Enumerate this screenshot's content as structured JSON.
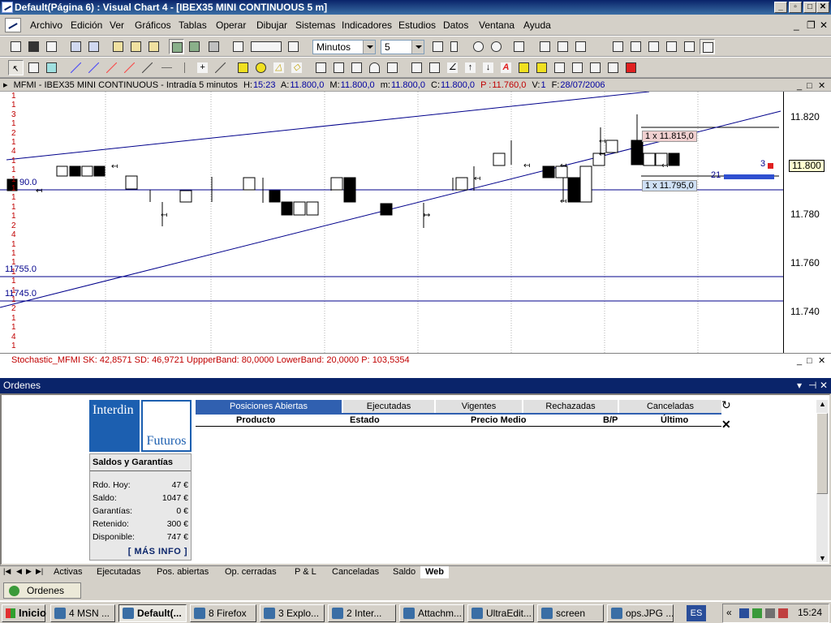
{
  "window": {
    "title": "Default(Página 6) : Visual Chart 4 - [IBEX35 MINI CONTINUOUS 5 m]"
  },
  "menu": [
    "Archivo",
    "Edición",
    "Ver",
    "Gráficos",
    "Tablas",
    "Operar",
    "Dibujar",
    "Sistemas",
    "Indicadores",
    "Estudios",
    "Datos",
    "Ventana",
    "Ayuda"
  ],
  "toolbar": {
    "period_select": "Minutos",
    "interval_select": "5"
  },
  "chart_header": {
    "symbol": "MFMI - IBEX35 MINI CONTINUOUS - Intradía 5 minutos",
    "hour_label": "H:",
    "hour": "15:23",
    "open_label": "A:",
    "open": "11.800,0",
    "high_label": "M:",
    "high": "11.800,0",
    "low_label": "m:",
    "low": "11.800,0",
    "close_label": "C:",
    "close": "11.800,0",
    "p_label": "P :",
    "p": "11.760,0",
    "vol_label": "V:",
    "vol": "1",
    "date_label": "F:",
    "date": "28/07/2006"
  },
  "chart": {
    "price_labels": [
      "11.820",
      "11.800",
      "11.780",
      "11.760",
      "11.740"
    ],
    "current_price": "11.800",
    "order_sell": "1 x 11.815,0",
    "order_buy": "1 x 11.795,0",
    "level_90": "90.0",
    "level_11755": "11755.0",
    "level_11745": "11745.0",
    "depth_left": "21",
    "depth_right": "3",
    "left_digits": [
      "1",
      "1",
      "3",
      "1",
      "2",
      "1",
      "4",
      "1",
      "1",
      "1",
      "1",
      "1",
      "1",
      "1",
      "2",
      "4",
      "1",
      "1",
      "1",
      "1",
      "1",
      "1",
      "1",
      "2",
      "1",
      "1",
      "4",
      "1"
    ],
    "colors": {
      "candle_up": "#ffffff",
      "candle_down": "#000000",
      "trend": "#00008b",
      "grid": "#b0b0b0",
      "sell_box": "#f0d0d0",
      "buy_box": "#cfe0f5",
      "marker": "#e02020"
    }
  },
  "stochastic": {
    "name": "Stochastic_MFMI",
    "sk_label": "SK:",
    "sk": "42,8571",
    "sd_label": "SD:",
    "sd": "46,9721",
    "upper_label": "UppperBand:",
    "upper": "80,0000",
    "lower_label": "LowerBand:",
    "lower": "20,0000",
    "p_label": "P:",
    "p": "103,5354"
  },
  "orders": {
    "panel_title": "Ordenes",
    "logo_top": "Interdin",
    "logo_bottom": "Futuros",
    "saldos_title": "Saldos y Garantías",
    "saldos": [
      {
        "label": "Rdo. Hoy:",
        "value": "47 €"
      },
      {
        "label": "Saldo:",
        "value": "1047 €"
      },
      {
        "label": "Garantías:",
        "value": "0 €"
      },
      {
        "label": "Retenido:",
        "value": "300 €"
      },
      {
        "label": "Disponible:",
        "value": "747 €"
      }
    ],
    "mas_info": "[ MÁS INFO ]",
    "tabs": [
      "Posiciones Abiertas",
      "Ejecutadas",
      "Vigentes",
      "Rechazadas",
      "Canceladas"
    ],
    "columns": [
      "Producto",
      "Estado",
      "Precio Medio",
      "B/P",
      "Último"
    ]
  },
  "sheet_tabs": [
    "Activas",
    "Ejecutadas",
    "Pos. abiertas",
    "Op. cerradas",
    "P & L",
    "Canceladas",
    "Saldo",
    "Web"
  ],
  "bottom_tab": "Ordenes",
  "taskbar": {
    "start": "Inicio",
    "items": [
      "4 MSN ...",
      "Default(...",
      "8 Firefox",
      "3 Explo...",
      "2 Inter...",
      "Attachm...",
      "UltraEdit...",
      "screen",
      "ops.JPG ..."
    ],
    "lang": "ES",
    "clock": "15:24"
  }
}
